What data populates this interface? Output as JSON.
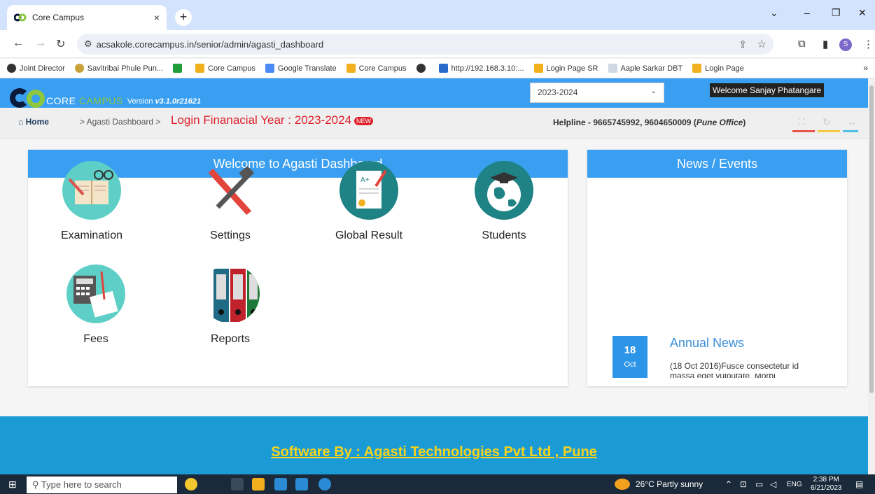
{
  "browser": {
    "tab_title": "Core Campus",
    "tab_close": "×",
    "new_tab": "+",
    "url": "acsakole.corecampus.in/senior/admin/agasti_dashboard",
    "avatar_letter": "S",
    "bookmarks": [
      "Joint Director",
      "Savitribai Phule Pun...",
      "",
      "Core Campus",
      "Google Translate",
      "Core Campus",
      "",
      "http://192.168.3.10:...",
      "Login Page SR",
      "Aaple Sarkar DBT",
      "Login Page"
    ],
    "bookmarks_more": "»"
  },
  "header": {
    "logo_core": "CORE",
    "logo_campus": "CAMPUS",
    "version_label": "Version",
    "version": "v3.1.0r21621",
    "year_selected": "2023-2024",
    "welcome": "Welcome Sanjay Phatangare"
  },
  "breadcrumb": {
    "home": "Home",
    "current": "> Agasti Dashboard >",
    "fin_year": "Login Finanacial Year : 2023-2024",
    "new_badge": "NEW",
    "helpline": "Helpline - 9665745992, 9604650009 (",
    "helpline_office": "Pune Office",
    "helpline_end": ")"
  },
  "dashboard": {
    "title": "Welcome to Agasti Dashboard",
    "tiles": [
      "Examination",
      "Settings",
      "Global Result",
      "Students",
      "Fees",
      "Reports"
    ]
  },
  "news": {
    "title": "News / Events",
    "day": "18",
    "month": "Oct",
    "heading": "Annual News",
    "body": "(18 Oct 2016)Fusce consectetur id",
    "body2": "massa eget vulputate. Morbi"
  },
  "footer": {
    "text": "Software By : Agasti Technologies Pvt Ltd , Pune"
  },
  "taskbar": {
    "search_placeholder": "Type here to search",
    "weather": "26°C  Partly sunny",
    "lang": "ENG",
    "time": "2:38 PM",
    "date": "6/21/2023"
  },
  "colors": {
    "header_blue": "#3a9ff0",
    "footer_blue": "#1a9bd5",
    "footer_text": "#f6d31c",
    "fin_year_red": "#e0212c"
  }
}
